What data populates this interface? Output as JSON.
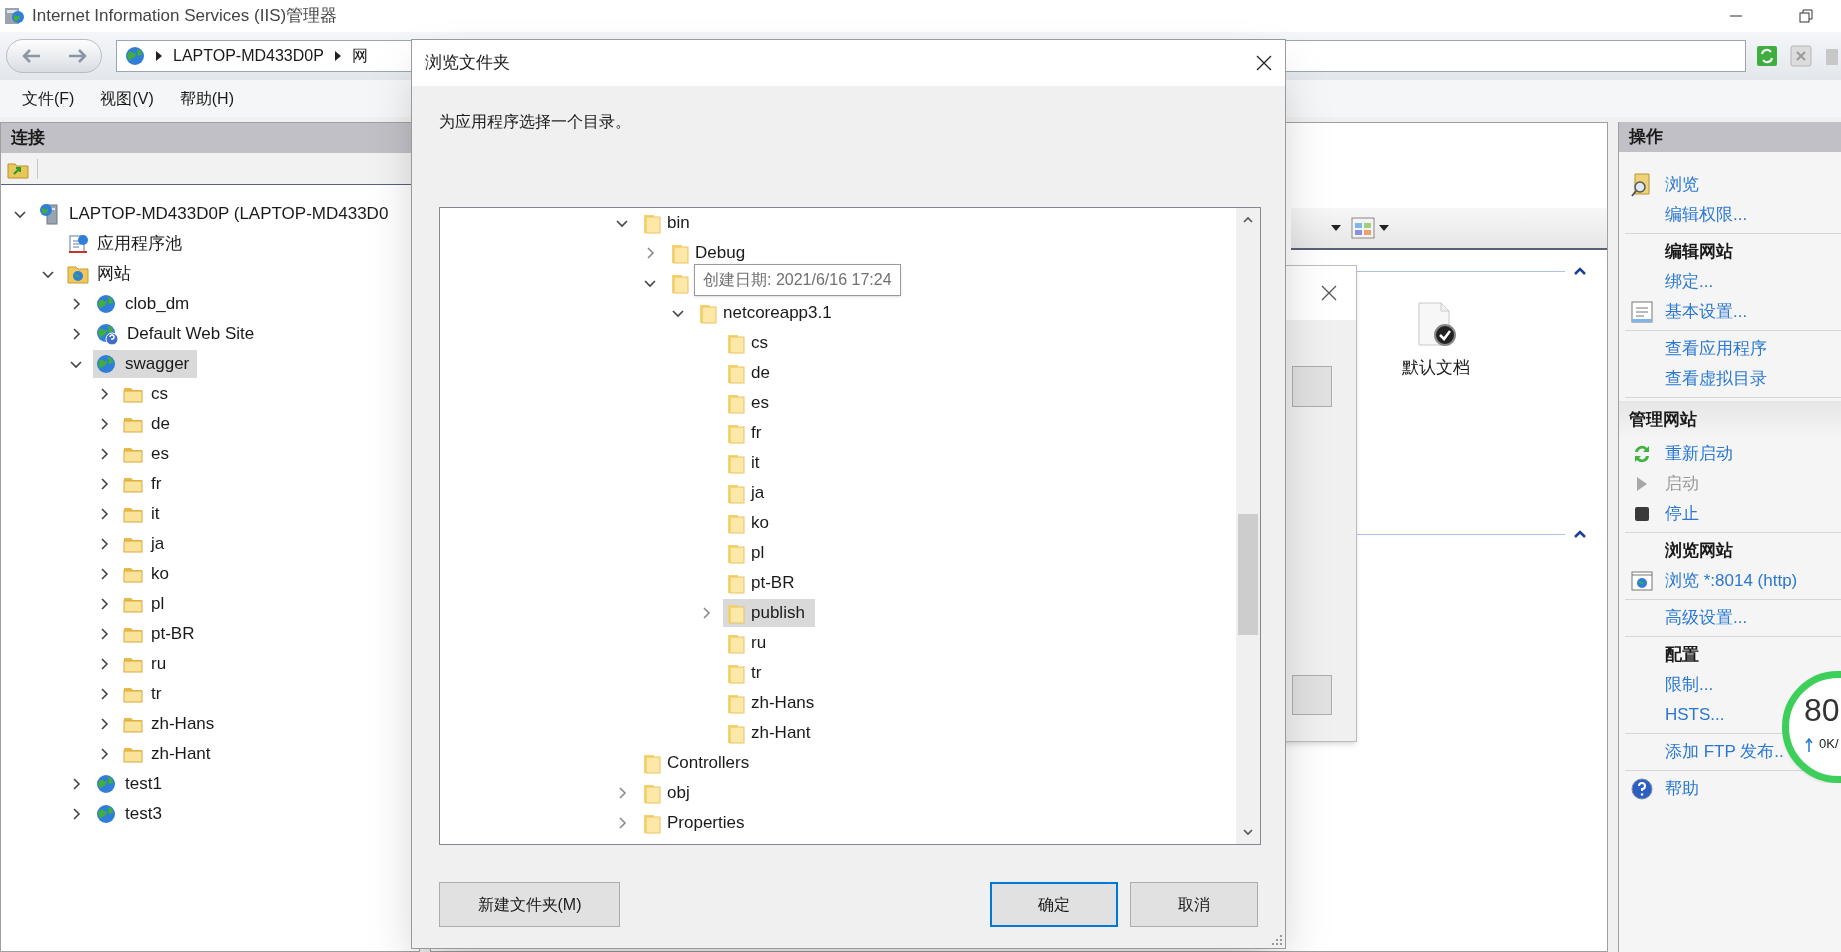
{
  "window": {
    "title": "Internet Information Services (IIS)管理器"
  },
  "address_bar": {
    "segments": [
      "LAPTOP-MD433D0P",
      "网"
    ]
  },
  "menu": [
    "文件(F)",
    "视图(V)",
    "帮助(H)"
  ],
  "connections": {
    "title": "连接",
    "tree": [
      {
        "label": "LAPTOP-MD433D0P (LAPTOP-MD433D0",
        "kind": "server",
        "expanded": true,
        "selected": false,
        "children": [
          {
            "label": "应用程序池",
            "kind": "pool",
            "selected": false
          },
          {
            "label": "网站",
            "kind": "sites",
            "expanded": true,
            "selected": false,
            "children": [
              {
                "label": "clob_dm",
                "kind": "site",
                "expanded": false,
                "selected": false
              },
              {
                "label": "Default Web Site",
                "kind": "default-site",
                "expanded": false,
                "selected": false
              },
              {
                "label": "swagger",
                "kind": "site",
                "expanded": true,
                "selected": true,
                "children": [
                  {
                    "label": "cs",
                    "kind": "folder",
                    "expanded": false,
                    "selected": false
                  },
                  {
                    "label": "de",
                    "kind": "folder",
                    "expanded": false,
                    "selected": false
                  },
                  {
                    "label": "es",
                    "kind": "folder",
                    "expanded": false,
                    "selected": false
                  },
                  {
                    "label": "fr",
                    "kind": "folder",
                    "expanded": false,
                    "selected": false
                  },
                  {
                    "label": "it",
                    "kind": "folder",
                    "expanded": false,
                    "selected": false
                  },
                  {
                    "label": "ja",
                    "kind": "folder",
                    "expanded": false,
                    "selected": false
                  },
                  {
                    "label": "ko",
                    "kind": "folder",
                    "expanded": false,
                    "selected": false
                  },
                  {
                    "label": "pl",
                    "kind": "folder",
                    "expanded": false,
                    "selected": false
                  },
                  {
                    "label": "pt-BR",
                    "kind": "folder",
                    "expanded": false,
                    "selected": false
                  },
                  {
                    "label": "ru",
                    "kind": "folder",
                    "expanded": false,
                    "selected": false
                  },
                  {
                    "label": "tr",
                    "kind": "folder",
                    "expanded": false,
                    "selected": false
                  },
                  {
                    "label": "zh-Hans",
                    "kind": "folder",
                    "expanded": false,
                    "selected": false
                  },
                  {
                    "label": "zh-Hant",
                    "kind": "folder",
                    "expanded": false,
                    "selected": false
                  }
                ]
              },
              {
                "label": "test1",
                "kind": "site",
                "expanded": false,
                "selected": false
              },
              {
                "label": "test3",
                "kind": "site",
                "expanded": false,
                "selected": false
              }
            ]
          }
        ]
      }
    ]
  },
  "features": [
    {
      "label": "默认文档"
    }
  ],
  "actions": {
    "title": "操作",
    "sections": [
      {
        "items": [
          {
            "label": "浏览",
            "disabled": false
          },
          {
            "label": "编辑权限...",
            "disabled": false
          }
        ]
      },
      {
        "heading": "编辑网站",
        "items": [
          {
            "label": "绑定...",
            "disabled": false
          },
          {
            "label": "基本设置...",
            "disabled": false
          }
        ]
      },
      {
        "items": [
          {
            "label": "查看应用程序",
            "disabled": false
          },
          {
            "label": "查看虚拟目录",
            "disabled": false
          }
        ]
      }
    ]
  },
  "manage": {
    "title": "管理网站",
    "sections": [
      {
        "items": [
          {
            "label": "重新启动",
            "disabled": false
          },
          {
            "label": "启动",
            "disabled": true
          },
          {
            "label": "停止",
            "disabled": false
          }
        ]
      },
      {
        "heading": "浏览网站",
        "items": [
          {
            "label": "浏览 *:8014 (http)",
            "disabled": false
          }
        ]
      },
      {
        "items": [
          {
            "label": "高级设置...",
            "disabled": false
          }
        ]
      },
      {
        "heading": "配置",
        "items": [
          {
            "label": "限制...",
            "disabled": false
          },
          {
            "label": "HSTS...",
            "disabled": false
          }
        ]
      },
      {
        "items": [
          {
            "label": "添加 FTP 发布..",
            "disabled": false
          }
        ]
      },
      {
        "items": [
          {
            "label": "帮助",
            "disabled": false
          }
        ]
      }
    ]
  },
  "dialog": {
    "title": "浏览文件夹",
    "prompt": "为应用程序选择一个目录。",
    "tooltip": "创建日期: 2021/6/16 17:24",
    "tree": [
      {
        "label": "bin",
        "expanded": true,
        "selected": false,
        "children": [
          {
            "label": "Debug",
            "expanded": false,
            "selected": false
          },
          {
            "expanded": true,
            "selected": false,
            "children": [
              {
                "label": "netcoreapp3.1",
                "expanded": true,
                "selected": false,
                "children": [
                  {
                    "label": "cs",
                    "selected": false
                  },
                  {
                    "label": "de",
                    "selected": false
                  },
                  {
                    "label": "es",
                    "selected": false
                  },
                  {
                    "label": "fr",
                    "selected": false
                  },
                  {
                    "label": "it",
                    "selected": false
                  },
                  {
                    "label": "ja",
                    "selected": false
                  },
                  {
                    "label": "ko",
                    "selected": false
                  },
                  {
                    "label": "pl",
                    "selected": false
                  },
                  {
                    "label": "pt-BR",
                    "selected": false
                  },
                  {
                    "label": "publish",
                    "expanded": false,
                    "selected": true
                  },
                  {
                    "label": "ru",
                    "selected": false
                  },
                  {
                    "label": "tr",
                    "selected": false
                  },
                  {
                    "label": "zh-Hans",
                    "selected": false
                  },
                  {
                    "label": "zh-Hant",
                    "selected": false
                  }
                ]
              }
            ]
          }
        ]
      },
      {
        "label": "Controllers",
        "selected": false
      },
      {
        "label": "obj",
        "expanded": false,
        "selected": false
      },
      {
        "label": "Properties",
        "expanded": false,
        "selected": false
      }
    ],
    "buttons": [
      {
        "label": "新建文件夹(M)",
        "default": false
      },
      {
        "label": "确定",
        "default": true
      },
      {
        "label": "取消",
        "default": false
      }
    ]
  },
  "network_widget": {
    "value": "80",
    "rate": "0K/"
  }
}
